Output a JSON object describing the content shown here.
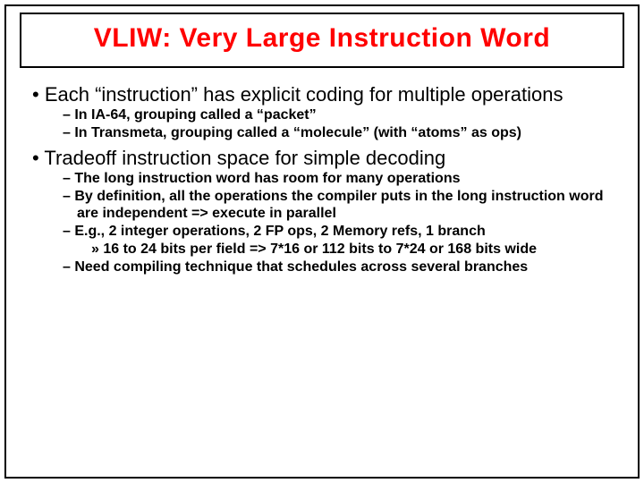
{
  "title": "VLIW: Very Large Instruction Word",
  "bullets": {
    "b1": "Each “instruction” has explicit coding for multiple operations",
    "b1s1": "In IA-64, grouping called a “packet”",
    "b1s2": "In Transmeta, grouping called a “molecule” (with “atoms” as ops)",
    "b2": "Tradeoff instruction space for simple decoding",
    "b2s1": "The long instruction word has room for many operations",
    "b2s2": "By definition, all the operations the compiler puts in the long instruction word are independent => execute in parallel",
    "b2s3": "E.g., 2 integer operations, 2 FP ops, 2 Memory refs, 1 branch",
    "b2s3a": "16 to 24 bits per field => 7*16 or 112 bits to 7*24 or 168 bits wide",
    "b2s4": "Need compiling technique that schedules across several branches"
  }
}
